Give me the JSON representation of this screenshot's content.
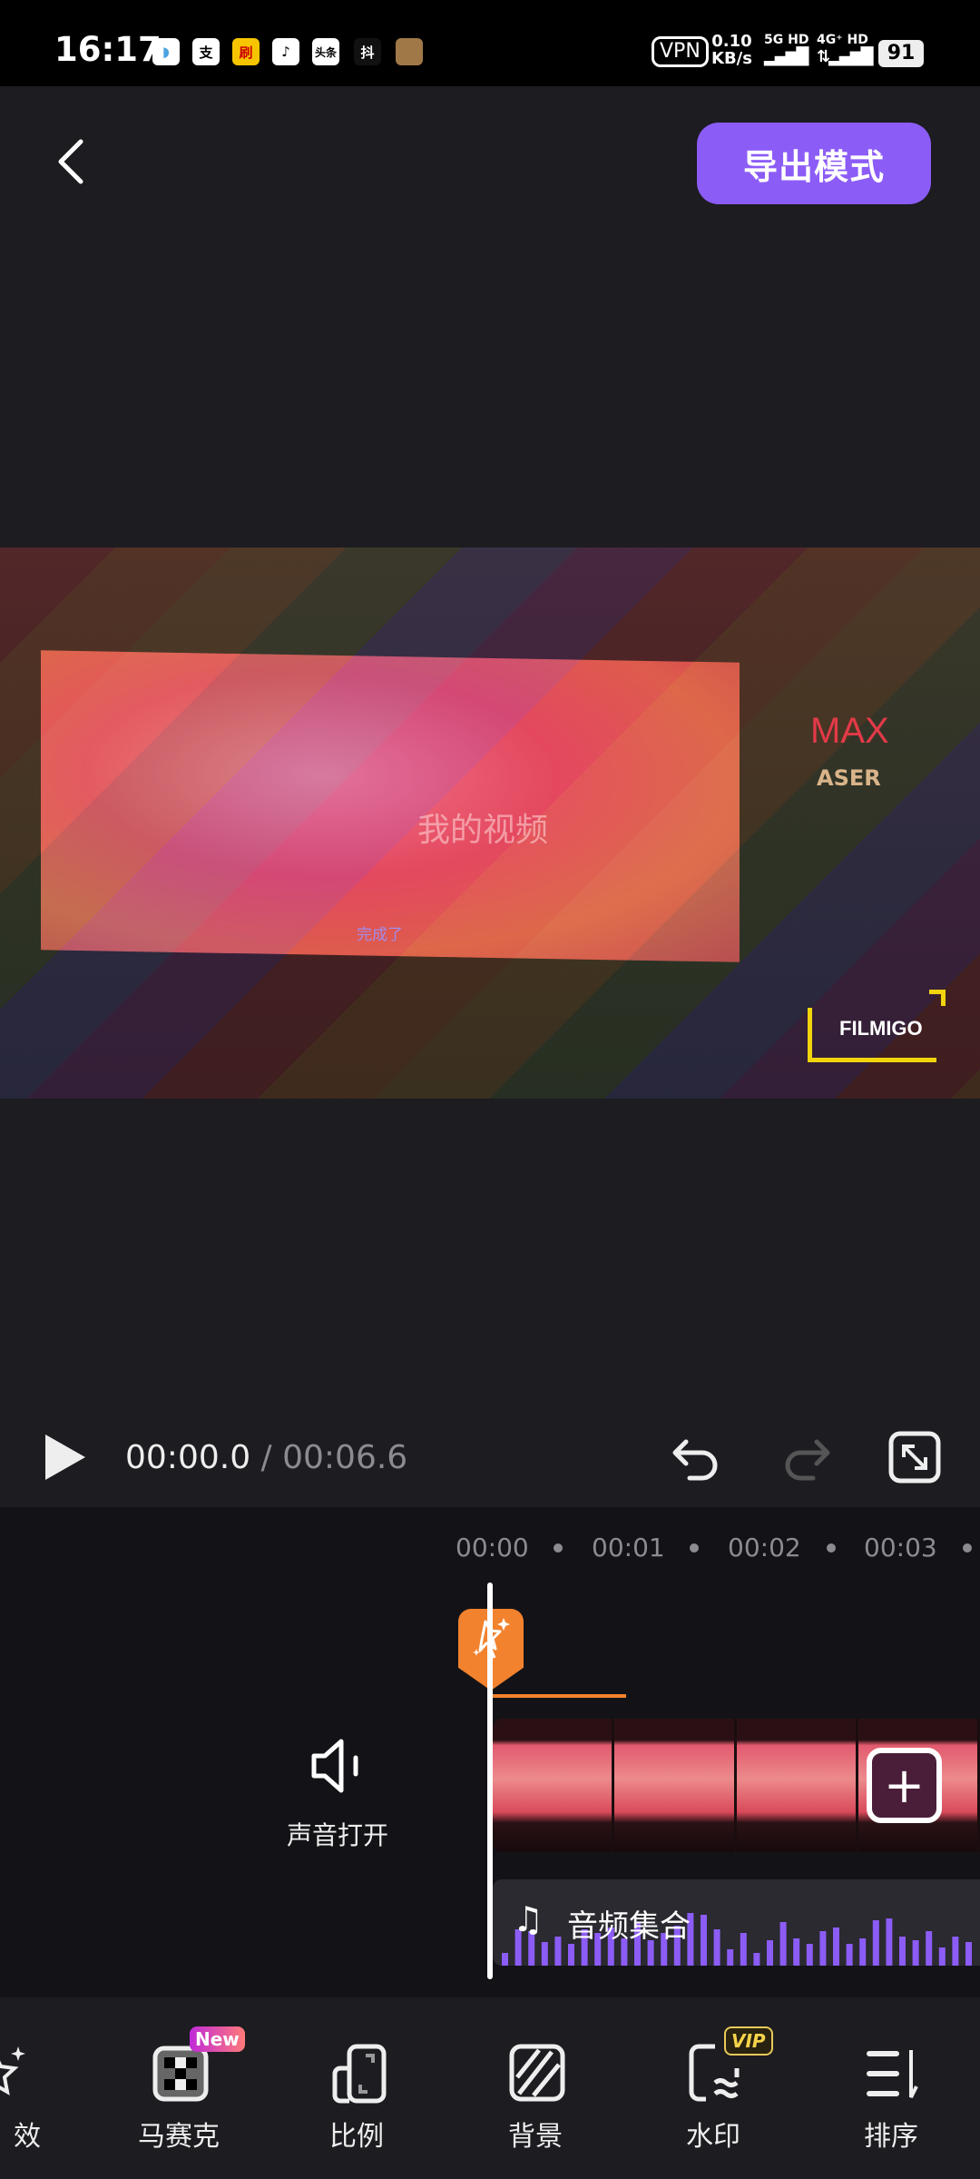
{
  "status_bar": {
    "time": "16:17",
    "vpn": "VPN",
    "speed_value": "0.10",
    "speed_unit": "KB/s",
    "sim1": "5G HD",
    "sim2": "4G⁺ HD",
    "battery": "91",
    "apps": [
      "whale",
      "支",
      "刷",
      "♪",
      "头条",
      "抖",
      "game"
    ]
  },
  "header": {
    "back_icon": "chevron-left-icon",
    "export_label": "导出模式",
    "accent": "#8c5cf6"
  },
  "preview": {
    "title_text": "我的视频",
    "subtitle_text": "完成了",
    "sign_top": "MAX",
    "sign_bottom": "ASER",
    "watermark": "FILMIGO"
  },
  "playback": {
    "current": "00:00.0",
    "separator": " / ",
    "total": "00:06.6"
  },
  "timeline": {
    "ticks": [
      "00:00",
      "00:01",
      "00:02",
      "00:03"
    ],
    "effect_color": "#f2822e",
    "sound_label": "声音打开",
    "audio_label": "音频集合",
    "audio_color": "#8c5cf6"
  },
  "toolbar": {
    "items": [
      {
        "label": "特效",
        "visible": "效",
        "icon": "magic-wand-icon"
      },
      {
        "label": "马赛克",
        "icon": "mosaic-icon",
        "badge": "New"
      },
      {
        "label": "比例",
        "icon": "aspect-ratio-icon"
      },
      {
        "label": "背景",
        "icon": "background-icon"
      },
      {
        "label": "水印",
        "icon": "watermark-icon",
        "badge": "VIP"
      },
      {
        "label": "排序",
        "icon": "sort-icon"
      }
    ]
  }
}
